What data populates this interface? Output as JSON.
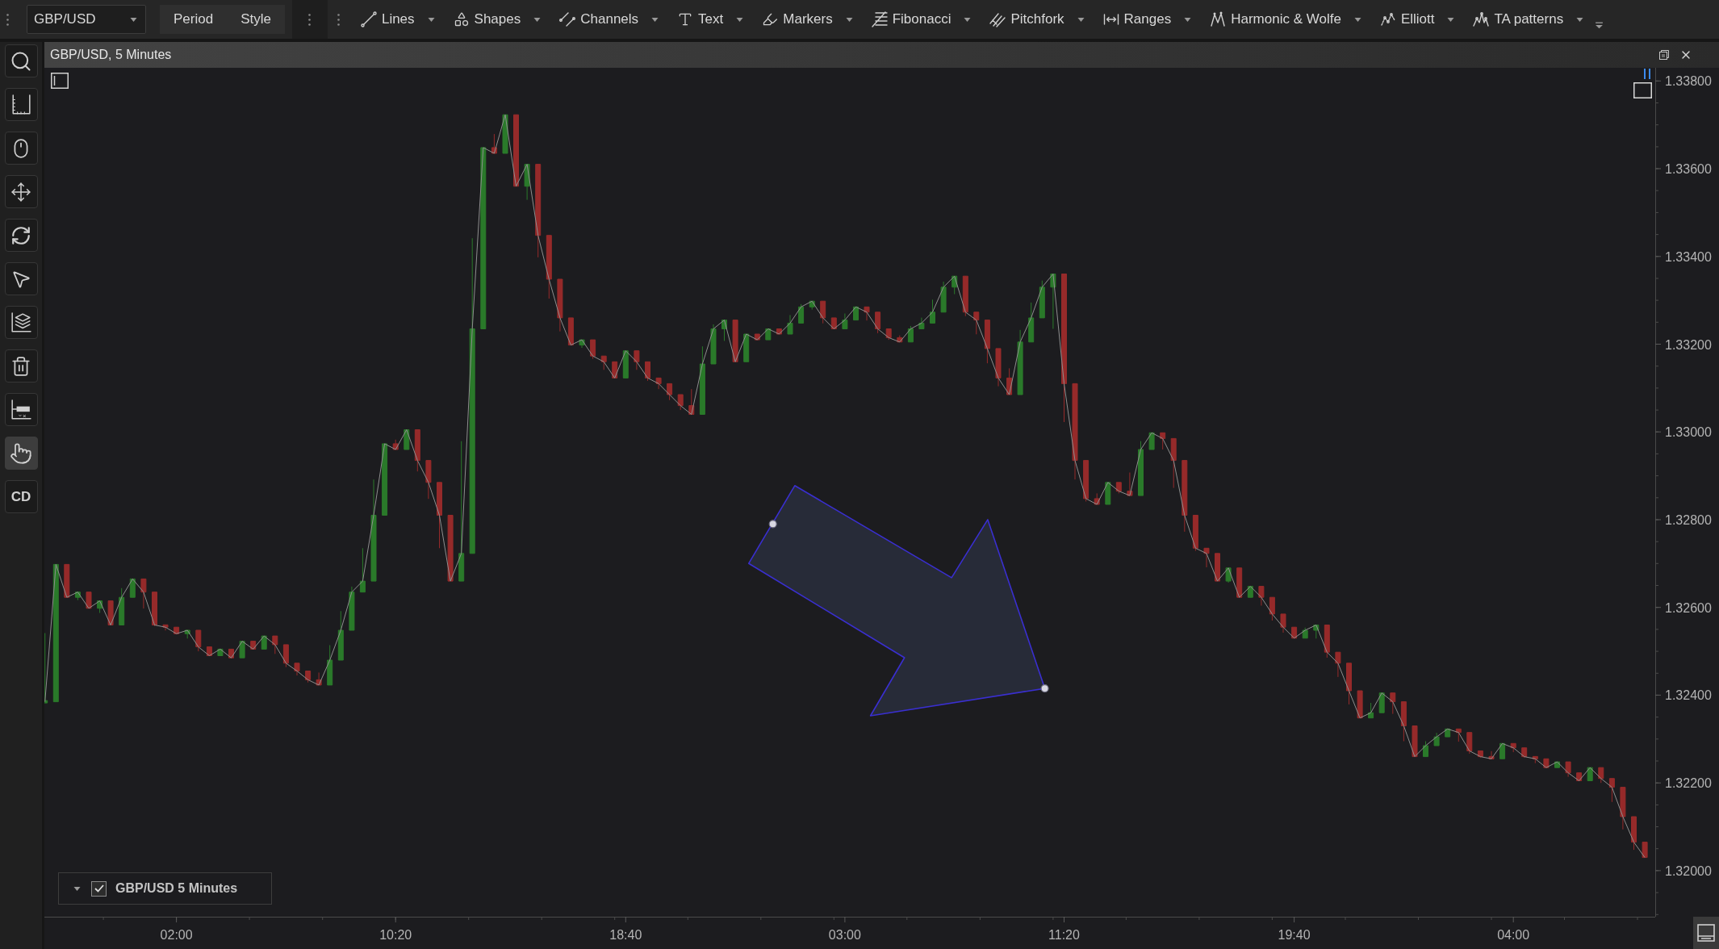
{
  "toolbar": {
    "symbol": "GBP/USD",
    "view_buttons": [
      "Period",
      "Style"
    ],
    "drawing_tools": [
      "Lines",
      "Shapes",
      "Channels",
      "Text",
      "Markers",
      "Fibonacci",
      "Pitchfork",
      "Ranges",
      "Harmonic & Wolfe",
      "Elliott",
      "TA patterns"
    ]
  },
  "side_tools": [
    {
      "selected": false
    },
    {
      "selected": false
    },
    {
      "selected": false
    },
    {
      "selected": false
    },
    {
      "selected": false
    },
    {
      "selected": false
    },
    {
      "selected": false
    },
    {
      "selected": false
    },
    {
      "selected": false
    },
    {
      "selected": true
    },
    {
      "label": "CD",
      "selected": false
    }
  ],
  "chart_window": {
    "title": "GBP/USD, 5 Minutes",
    "legend": {
      "checked": true
    },
    "drawings": [
      {
        "kind": "arrow",
        "selected": true
      }
    ],
    "chart_data": {
      "type": "line",
      "categories": [
        null,
        null,
        null,
        null,
        null,
        null,
        null,
        null,
        null,
        null,
        null,
        null,
        "02:00",
        null,
        null,
        null,
        null,
        null,
        null,
        null,
        null,
        null,
        null,
        null,
        null,
        null,
        null,
        null,
        null,
        null,
        null,
        null,
        "10:20",
        null,
        null,
        null,
        null,
        null,
        null,
        null,
        null,
        null,
        null,
        null,
        null,
        null,
        null,
        null,
        null,
        null,
        null,
        null,
        null,
        "18:40",
        null,
        null,
        null,
        null,
        null,
        null,
        null,
        null,
        null,
        null,
        null,
        null,
        null,
        null,
        null,
        null,
        null,
        null,
        null,
        "03:00",
        null,
        null,
        null,
        null,
        null,
        null,
        null,
        null,
        null,
        null,
        null,
        null,
        null,
        null,
        null,
        null,
        null,
        null,
        null,
        "11:20",
        null,
        null,
        null,
        null,
        null,
        null,
        null,
        null,
        null,
        null,
        null,
        null,
        null,
        null,
        null,
        null,
        null,
        null,
        null,
        null,
        "19:40",
        null,
        null,
        null,
        null,
        null,
        null,
        null,
        null,
        null,
        null,
        null,
        null,
        null,
        null,
        null,
        null,
        null,
        null,
        null,
        "04:00",
        null,
        null,
        null,
        null,
        null,
        null,
        null,
        null,
        null,
        null,
        null,
        null
      ],
      "ylim": [
        1.31895,
        1.3383
      ],
      "yticks": [
        {
          "value": 1.338,
          "label": "1.33800"
        },
        {
          "value": 1.336,
          "label": "1.33600"
        },
        {
          "value": 1.334,
          "label": "1.33400"
        },
        {
          "value": 1.332,
          "label": "1.33200"
        },
        {
          "value": 1.33,
          "label": "1.33000"
        },
        {
          "value": 1.328,
          "label": "1.32800"
        },
        {
          "value": 1.326,
          "label": "1.32600"
        },
        {
          "value": 1.324,
          "label": "1.32400"
        },
        {
          "value": 1.322,
          "label": "1.32200"
        },
        {
          "value": 1.32,
          "label": "1.32000"
        }
      ],
      "series": [
        {
          "name": "GBP/USD 5 Minutes",
          "values": [
            1.32385,
            1.32698,
            1.32623,
            1.32635,
            1.32598,
            1.32615,
            1.3256,
            1.32623,
            1.32665,
            1.32635,
            1.3256,
            1.32555,
            1.3254,
            1.32548,
            1.3251,
            1.3249,
            1.32505,
            1.32485,
            1.32523,
            1.32505,
            1.32535,
            1.32515,
            1.32473,
            1.32455,
            1.32435,
            1.32423,
            1.3248,
            1.32548,
            1.32635,
            1.3266,
            1.3281,
            1.32973,
            1.3296,
            1.33005,
            1.32935,
            1.32885,
            1.3281,
            1.3266,
            1.32723,
            1.33235,
            1.33648,
            1.33635,
            1.33723,
            1.3356,
            1.3361,
            1.33448,
            1.33348,
            1.3326,
            1.33198,
            1.3321,
            1.33173,
            1.3316,
            1.33123,
            1.33185,
            1.3316,
            1.33123,
            1.3311,
            1.33085,
            1.3306,
            1.3304,
            1.33155,
            1.33235,
            1.33255,
            1.3316,
            1.33223,
            1.3321,
            1.33235,
            1.33223,
            1.33248,
            1.33285,
            1.33298,
            1.3326,
            1.33235,
            1.33255,
            1.33285,
            1.33273,
            1.33235,
            1.33215,
            1.33205,
            1.33235,
            1.33248,
            1.33273,
            1.3333,
            1.33355,
            1.33273,
            1.33255,
            1.3319,
            1.33123,
            1.33085,
            1.33205,
            1.3326,
            1.3333,
            1.3336,
            1.3311,
            1.32935,
            1.32848,
            1.32835,
            1.32885,
            1.32865,
            1.32855,
            1.3296,
            1.32998,
            1.32985,
            1.32935,
            1.3281,
            1.32735,
            1.32723,
            1.3266,
            1.3269,
            1.32623,
            1.32648,
            1.32623,
            1.32585,
            1.32555,
            1.3253,
            1.32548,
            1.3256,
            1.32498,
            1.32473,
            1.3241,
            1.32348,
            1.3236,
            1.32405,
            1.32385,
            1.3233,
            1.3226,
            1.32285,
            1.32305,
            1.32323,
            1.32315,
            1.32273,
            1.3226,
            1.32255,
            1.3229,
            1.3228,
            1.3226,
            1.32255,
            1.32235,
            1.32248,
            1.32223,
            1.32205,
            1.32235,
            1.3221,
            1.3219,
            1.32123,
            1.32065,
            1.3203
          ]
        }
      ]
    }
  }
}
